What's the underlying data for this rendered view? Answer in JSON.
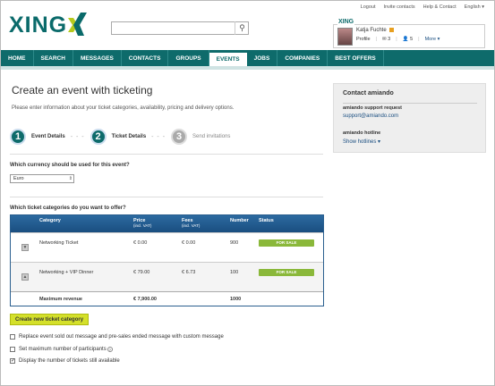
{
  "top_links": [
    "Logout",
    "Invite contacts",
    "Help & Contact",
    "English"
  ],
  "profile": {
    "logo": "XING",
    "name": "Katja Fuchte",
    "profile_label": "Profile",
    "messages_count": "3",
    "contacts_count": "5",
    "more_label": "More"
  },
  "brand": {
    "logo_text": "XING",
    "color": "#0e6b6b"
  },
  "search": {
    "placeholder": ""
  },
  "nav": [
    "HOME",
    "SEARCH",
    "MESSAGES",
    "CONTACTS",
    "GROUPS",
    "EVENTS",
    "JOBS",
    "COMPANIES",
    "BEST OFFERS"
  ],
  "nav_active": "EVENTS",
  "page_title": "Create an event with ticketing",
  "intro": "Please enter information about your ticket categories, availability, pricing and delivery options.",
  "steps": [
    {
      "number": "1",
      "label": "Event Details",
      "state": "done"
    },
    {
      "number": "2",
      "label": "Ticket Details",
      "state": "active"
    },
    {
      "number": "3",
      "label": "Send invitations",
      "state": "upcoming"
    }
  ],
  "currency_question": "Which currency should be used for this event?",
  "currency_value": "Euro",
  "categories_question": "Which ticket categories do you want to offer?",
  "table": {
    "headers": {
      "category": "Category",
      "price": "Price",
      "price_sub": "(incl. VAT)",
      "fees": "Fees",
      "fees_sub": "(incl. VAT)",
      "number": "Number",
      "status": "Status"
    },
    "rows": [
      {
        "category": "Networking Ticket",
        "price": "€ 0.00",
        "fees": "€ 0.00",
        "number": "900",
        "status": "FOR SALE"
      },
      {
        "category": "Networking + VIP Dinner",
        "price": "€ 79.00",
        "fees": "€ 6.73",
        "number": "100",
        "status": "FOR SALE"
      }
    ],
    "footer": {
      "label": "Maximum revenue",
      "price": "€ 7,900.00",
      "number": "1000"
    }
  },
  "create_button": "Create new ticket category",
  "options": [
    {
      "label": "Replace event sold out message and pre-sales ended message with custom message",
      "checked": false
    },
    {
      "label": "Set maximum number of participants",
      "checked": false
    },
    {
      "label": "Display the number of tickets still available",
      "checked": true
    }
  ],
  "sidebar": {
    "title": "Contact amiando",
    "support_label": "amiando support request",
    "support_email": "support@amiando.com",
    "hotline_label": "amiando hotline",
    "show_hotlines": "Show hotlines"
  },
  "colors": {
    "status_green": "#8ab83a",
    "table_header": "#2c6aa0",
    "create_button": "#d4e02a"
  }
}
